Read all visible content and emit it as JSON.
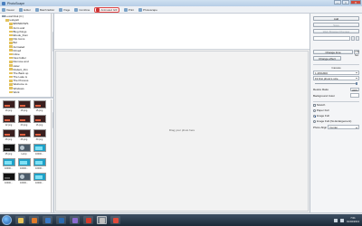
{
  "window": {
    "title": "PhotoScape",
    "controls": {
      "minimize": "—",
      "maximize": "□",
      "close": "✕"
    }
  },
  "toolbar": {
    "items": [
      {
        "label": "Viewer",
        "icon": "viewer-icon",
        "active": false
      },
      {
        "label": "Editor",
        "icon": "editor-icon",
        "active": false
      },
      {
        "label": "Batch Editor",
        "icon": "batch-editor-icon",
        "active": false
      },
      {
        "label": "Page",
        "icon": "page-icon",
        "active": false
      },
      {
        "label": "Combine",
        "icon": "combine-icon",
        "active": false
      },
      {
        "label": "Animated GIF",
        "icon": "gif-icon",
        "active": true
      },
      {
        "label": "Print",
        "icon": "print-icon",
        "active": false
      },
      {
        "label": "Photoscape",
        "icon": "photoscape-icon",
        "active": false
      }
    ]
  },
  "folder_tree": {
    "items": [
      {
        "label": "Local Disk (C:)",
        "icon": "drive-icon",
        "indent": 0
      },
      {
        "label": "ieskyaC",
        "icon": "folder-icon",
        "indent": 1
      },
      {
        "label": "$WINDOWS",
        "icon": "folder-icon",
        "indent": 2
      },
      {
        "label": "Anim and",
        "icon": "folder-icon",
        "indent": 2
      },
      {
        "label": "Blog things",
        "icon": "folder-icon",
        "indent": 2
      },
      {
        "label": "Ebook_Dom",
        "icon": "folder-icon",
        "indent": 2
      },
      {
        "label": "Flip Icons",
        "icon": "folder-icon",
        "indent": 2
      },
      {
        "label": "Bot",
        "icon": "folder-icon",
        "indent": 2
      },
      {
        "label": "Animated",
        "icon": "folder-icon",
        "indent": 2
      },
      {
        "label": "Drived",
        "icon": "folder-icon",
        "indent": 2
      },
      {
        "label": "Inline",
        "icon": "folder-icon",
        "indent": 2
      },
      {
        "label": "New folder",
        "icon": "folder-icon",
        "indent": 2
      },
      {
        "label": "Remove and",
        "icon": "folder-icon",
        "indent": 2
      },
      {
        "label": "sister",
        "icon": "folder-icon",
        "indent": 2
      },
      {
        "label": "Rodent_thin",
        "icon": "folder-icon",
        "indent": 2
      },
      {
        "label": "The Back up",
        "icon": "folder-icon",
        "indent": 2
      },
      {
        "label": "The Lake is",
        "icon": "folder-icon",
        "indent": 2
      },
      {
        "label": "The Process",
        "icon": "folder-icon",
        "indent": 2
      },
      {
        "label": "Welcome to",
        "icon": "folder-icon",
        "indent": 2
      },
      {
        "label": "Windows",
        "icon": "folder-icon",
        "indent": 2
      },
      {
        "label": "Work",
        "icon": "folder-icon",
        "indent": 2
      }
    ]
  },
  "thumbnails": [
    {
      "label": "19.png",
      "style": "red"
    },
    {
      "label": "18.png",
      "style": "red"
    },
    {
      "label": "15.png",
      "style": "red"
    },
    {
      "label": "12.png",
      "style": "red"
    },
    {
      "label": "23.png",
      "style": "red"
    },
    {
      "label": "16.png",
      "style": "red"
    },
    {
      "label": "28.png",
      "style": "red"
    },
    {
      "label": "26.png",
      "style": "red"
    },
    {
      "label": "30.png",
      "style": "red"
    },
    {
      "label": "25.png",
      "style": "dark"
    },
    {
      "label": "Lamp",
      "style": "photo"
    },
    {
      "label": "10000...",
      "style": "cyan"
    },
    {
      "label": "10000...",
      "style": "cyan"
    },
    {
      "label": "10000...",
      "style": "cyan"
    },
    {
      "label": "10000...",
      "style": "cyan"
    },
    {
      "label": "10000...",
      "style": "dark"
    },
    {
      "label": "10000...",
      "style": "photo"
    },
    {
      "label": "10000...",
      "style": "cyan"
    }
  ],
  "canvas": {
    "hint": "Drag your photo here"
  },
  "right_panel": {
    "add_label": "Add",
    "save_label": "Save",
    "preview_label": "Web Browser Preview",
    "change_time_label": "Change time",
    "change_time_value": "0.50 Sec",
    "change_effect_label": "Change effect",
    "canvas_label": "Canvas",
    "canvas_value": "1,280x800",
    "fit_option": "Fit first photo's size",
    "resize_ratio_label": "Resize Ratio",
    "resize_ratio_value": "100%",
    "resize_ratio_level": 1.0,
    "background_label": "Background Color",
    "background_color": "#ffffff",
    "options": {
      "stretch": "Stretch",
      "paper_full": "Paper Full",
      "image_full": "Image Full",
      "image_full_no_enlarge": "Image Full (No Enlargement)"
    },
    "selected_option": "image_full",
    "align_label": "Photo Align",
    "align_value": "Center"
  },
  "taskbar": {
    "apps": [
      {
        "name": "explorer",
        "color": "#e8c45a",
        "active": false
      },
      {
        "name": "firefox",
        "color": "#e07a2a",
        "active": false
      },
      {
        "name": "media",
        "color": "#3a7ac8",
        "active": false
      },
      {
        "name": "photoshop",
        "color": "#2a6ab0",
        "active": false
      },
      {
        "name": "app",
        "color": "#8a6ad0",
        "active": false
      },
      {
        "name": "antivirus",
        "color": "#d43a2a",
        "active": false
      },
      {
        "name": "photoscape",
        "color": "#c0c0c0",
        "active": true
      },
      {
        "name": "chrome",
        "color": "#e04a3a",
        "active": false
      }
    ],
    "time": "7:01",
    "date": "01/02/2013"
  }
}
